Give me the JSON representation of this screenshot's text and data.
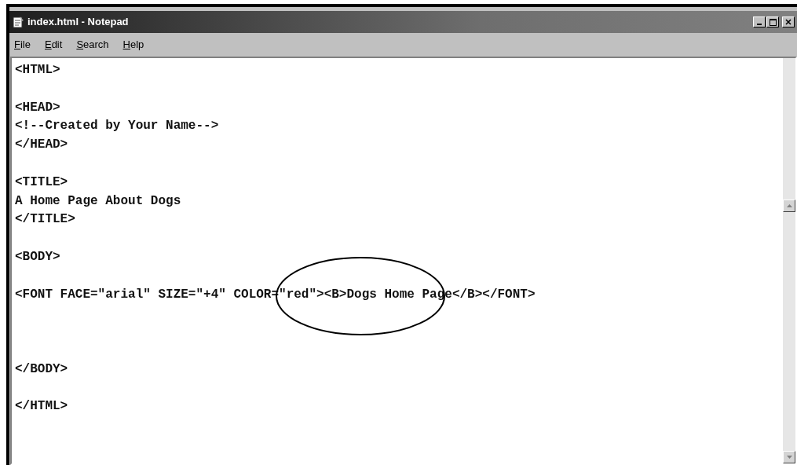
{
  "window": {
    "title": "index.html - Notepad"
  },
  "menu": [
    {
      "label": "File"
    },
    {
      "label": "Edit"
    },
    {
      "label": "Search"
    },
    {
      "label": "Help"
    }
  ],
  "editor": {
    "content": "<HTML>\n\n<HEAD>\n<!--Created by Your Name-->\n</HEAD>\n\n<TITLE>\nA Home Page About Dogs\n</TITLE>\n\n<BODY>\n\n<FONT FACE=\"arial\" SIZE=\"+4\" COLOR=\"red\"><B>Dogs Home Page</B></FONT>\n\n\n\n</BODY>\n\n</HTML>"
  },
  "annotation": {
    "kind": "ellipse"
  }
}
